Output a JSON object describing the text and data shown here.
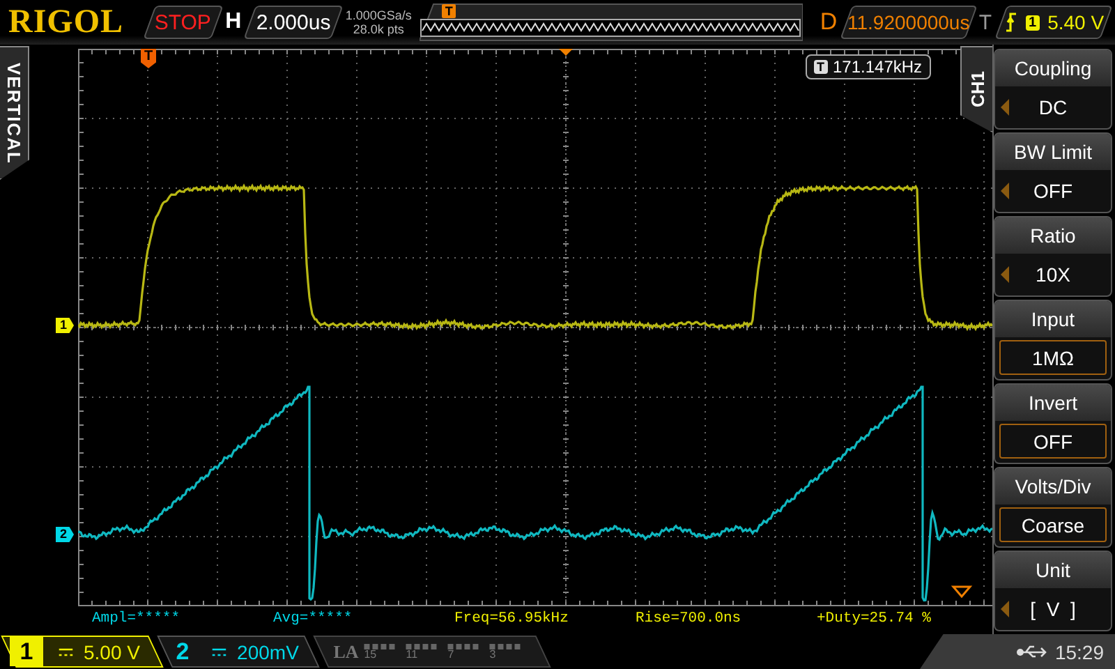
{
  "header": {
    "brand": "RIGOL",
    "run_state": "STOP",
    "timebase_label": "H",
    "timebase": "2.000us",
    "sample_rate": "1.000GSa/s",
    "memory_depth": "28.0k pts",
    "memory_marker": "T",
    "delay_label": "D",
    "delay": "11.9200000us",
    "trigger_label": "T",
    "trigger_source": "1",
    "trigger_level": "5.40 V"
  },
  "side_tab": "VERTICAL",
  "plot": {
    "trigger_position_marker": "T",
    "counter": {
      "icon": "T",
      "value": "171.147kHz"
    },
    "channel_markers": [
      {
        "label": "1",
        "color": "#f0f000"
      },
      {
        "label": "2",
        "color": "#00d8e8"
      }
    ]
  },
  "measurements": [
    "Ampl=*****",
    "Avg=*****",
    "Freq=56.95kHz",
    "Rise=700.0ns",
    "+Duty=25.74 %"
  ],
  "menu": {
    "title": "CH1",
    "items": [
      {
        "label": "Coupling",
        "value": "DC",
        "kind": "cycle"
      },
      {
        "label": "BW Limit",
        "value": "OFF",
        "kind": "cycle"
      },
      {
        "label": "Ratio",
        "value": "10X",
        "kind": "cycle"
      },
      {
        "label": "Input",
        "value": "1MΩ",
        "kind": "box"
      },
      {
        "label": "Invert",
        "value": "OFF",
        "kind": "box"
      },
      {
        "label": "Volts/Div",
        "value": "Coarse",
        "kind": "box"
      },
      {
        "label": "Unit",
        "value": "[  V  ]",
        "kind": "cycle"
      }
    ]
  },
  "channels": [
    {
      "number": "1",
      "scale": "5.00 V",
      "selected": true,
      "color": "#f0f000"
    },
    {
      "number": "2",
      "scale": "200mV",
      "selected": false,
      "color": "#00d8e8"
    }
  ],
  "logic_analyzer": {
    "label": "LA",
    "ticks": [
      "15",
      "11",
      "7",
      "3"
    ]
  },
  "status_bar": {
    "time": "15:29"
  }
}
